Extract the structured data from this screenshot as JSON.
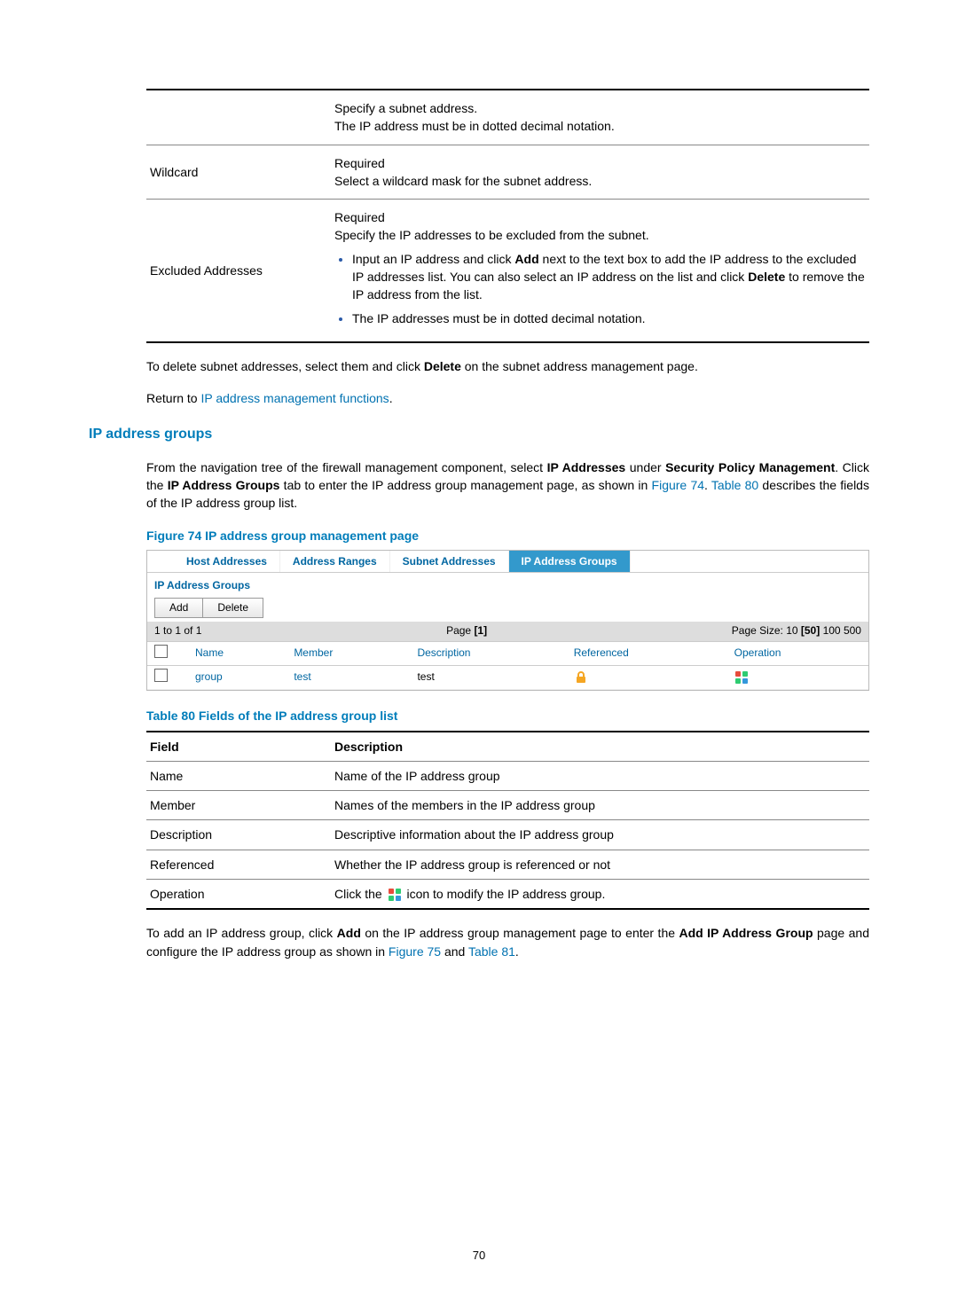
{
  "tableA": {
    "subnetRow": {
      "line1": "Specify a subnet address.",
      "line2": "The IP address must be in dotted decimal notation."
    },
    "wildcard": {
      "label": "Wildcard",
      "req": "Required",
      "desc": "Select a wildcard mask for the subnet address."
    },
    "excluded": {
      "label": "Excluded Addresses",
      "req": "Required",
      "desc": "Specify the IP addresses to be excluded from the subnet.",
      "b1a": "Input an IP address and click ",
      "b1_add": "Add",
      "b1b": " next to the text box to add the IP address to the excluded IP addresses list. You can also select an IP address on the list and click ",
      "b1_del": "Delete",
      "b1c": " to remove the IP address from the list.",
      "b2": "The IP addresses must be in dotted decimal notation."
    }
  },
  "midpara": {
    "p1a": "To delete subnet addresses, select them and click ",
    "p1b": "Delete",
    "p1c": " on the subnet address management page.",
    "p2a": "Return to ",
    "p2link": "IP address management functions",
    "p2c": "."
  },
  "section": {
    "title": "IP address groups",
    "p1a": "From the navigation tree of the firewall management component, select ",
    "p1b": "IP Addresses",
    "p1c": " under ",
    "p1d": "Security Policy Management",
    "p1e": ". Click the ",
    "p1f": "IP Address Groups",
    "p1g": " tab to enter the IP address group management page, as shown in ",
    "flink": "Figure 74",
    "p1h": ". ",
    "tlink": "Table 80",
    "p1i": " describes the fields of the IP address group list.",
    "figTitle": "Figure 74 IP address group management page",
    "t80Title": "Table 80 Fields of the IP address group list"
  },
  "shot": {
    "tabs": [
      "Host Addresses",
      "Address Ranges",
      "Subnet Addresses",
      "IP Address Groups"
    ],
    "activeTab": 3,
    "title": "IP Address Groups",
    "buttons": [
      "Add",
      "Delete"
    ],
    "pager": {
      "countLabel": "1 to 1 of 1",
      "pageLabel": "Page",
      "pageNum": "[1]",
      "sizeLabel": "Page Size:",
      "sizes": [
        "10",
        "[50]",
        "100",
        "500"
      ],
      "activeSize": 1
    },
    "headers": [
      "",
      "Name",
      "Member",
      "Description",
      "Referenced",
      "Operation"
    ],
    "row": {
      "name": "group",
      "member": "test",
      "desc": "test"
    }
  },
  "t80": {
    "h1": "Field",
    "h2": "Description",
    "rows": [
      {
        "f": "Name",
        "d": "Name of the IP address group"
      },
      {
        "f": "Member",
        "d": "Names of the members in the IP address group"
      },
      {
        "f": "Description",
        "d": "Descriptive information about the IP address group"
      },
      {
        "f": "Referenced",
        "d": "Whether the IP address group is referenced or not"
      }
    ],
    "opRow": {
      "f": "Operation",
      "d1": "Click the ",
      "d2": " icon to modify the IP address group."
    }
  },
  "bottom": {
    "p1a": "To add an IP address group, click ",
    "p1b": "Add",
    "p1c": " on the IP address group management page to enter the ",
    "p1d": "Add IP Address Group",
    "p1e": " page and configure the IP address group as shown in ",
    "flink": "Figure 75",
    "mid": " and ",
    "tlink": "Table 81",
    "end": "."
  },
  "pageNum": "70"
}
